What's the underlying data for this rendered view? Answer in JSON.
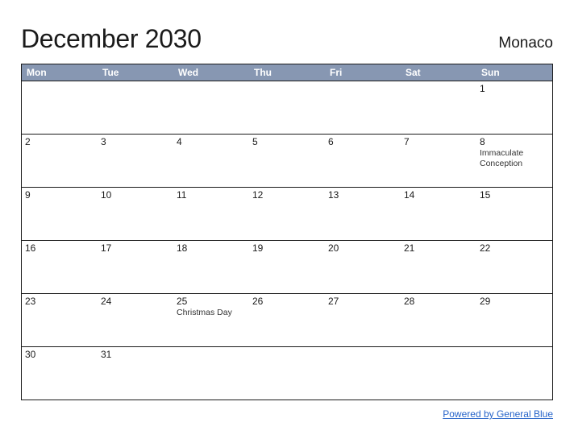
{
  "header": {
    "title": "December 2030",
    "country": "Monaco"
  },
  "day_labels": [
    "Mon",
    "Tue",
    "Wed",
    "Thu",
    "Fri",
    "Sat",
    "Sun"
  ],
  "weeks": [
    [
      {
        "day": "",
        "event": ""
      },
      {
        "day": "",
        "event": ""
      },
      {
        "day": "",
        "event": ""
      },
      {
        "day": "",
        "event": ""
      },
      {
        "day": "",
        "event": ""
      },
      {
        "day": "",
        "event": ""
      },
      {
        "day": "1",
        "event": ""
      }
    ],
    [
      {
        "day": "2",
        "event": ""
      },
      {
        "day": "3",
        "event": ""
      },
      {
        "day": "4",
        "event": ""
      },
      {
        "day": "5",
        "event": ""
      },
      {
        "day": "6",
        "event": ""
      },
      {
        "day": "7",
        "event": ""
      },
      {
        "day": "8",
        "event": "Immaculate Conception"
      }
    ],
    [
      {
        "day": "9",
        "event": ""
      },
      {
        "day": "10",
        "event": ""
      },
      {
        "day": "11",
        "event": ""
      },
      {
        "day": "12",
        "event": ""
      },
      {
        "day": "13",
        "event": ""
      },
      {
        "day": "14",
        "event": ""
      },
      {
        "day": "15",
        "event": ""
      }
    ],
    [
      {
        "day": "16",
        "event": ""
      },
      {
        "day": "17",
        "event": ""
      },
      {
        "day": "18",
        "event": ""
      },
      {
        "day": "19",
        "event": ""
      },
      {
        "day": "20",
        "event": ""
      },
      {
        "day": "21",
        "event": ""
      },
      {
        "day": "22",
        "event": ""
      }
    ],
    [
      {
        "day": "23",
        "event": ""
      },
      {
        "day": "24",
        "event": ""
      },
      {
        "day": "25",
        "event": "Christmas Day"
      },
      {
        "day": "26",
        "event": ""
      },
      {
        "day": "27",
        "event": ""
      },
      {
        "day": "28",
        "event": ""
      },
      {
        "day": "29",
        "event": ""
      }
    ],
    [
      {
        "day": "30",
        "event": ""
      },
      {
        "day": "31",
        "event": ""
      },
      {
        "day": "",
        "event": ""
      },
      {
        "day": "",
        "event": ""
      },
      {
        "day": "",
        "event": ""
      },
      {
        "day": "",
        "event": ""
      },
      {
        "day": "",
        "event": ""
      }
    ]
  ],
  "footer": {
    "powered_by": "Powered by General Blue"
  }
}
